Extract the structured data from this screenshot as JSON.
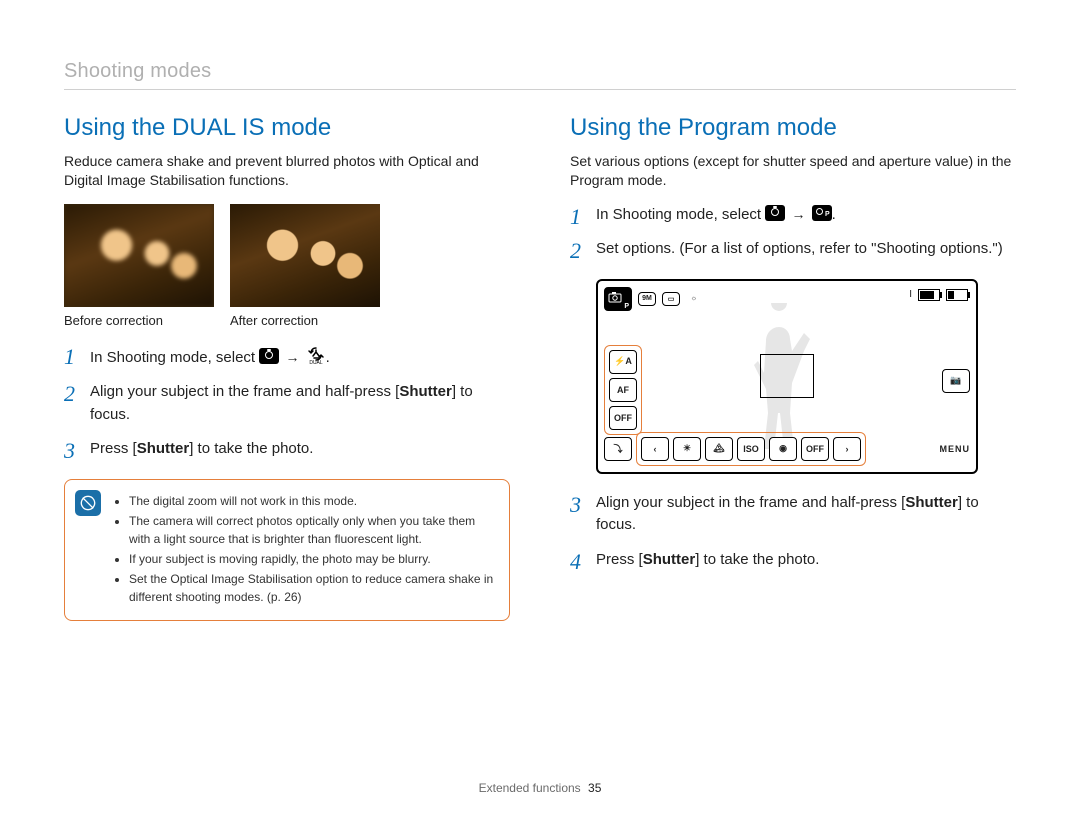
{
  "header": "Shooting modes",
  "left": {
    "title": "Using the DUAL IS mode",
    "intro": "Reduce camera shake and prevent blurred photos with Optical and Digital Image Stabilisation functions.",
    "caption_before": "Before correction",
    "caption_after": "After correction",
    "steps": {
      "1_prefix": "In Shooting mode, select ",
      "2_a": "Align your subject in the frame and half-press [",
      "2_shutter": "Shutter",
      "2_b": "] to focus.",
      "3_a": "Press [",
      "3_shutter": "Shutter",
      "3_b": "] to take the photo."
    },
    "notes": [
      "The digital zoom will not work in this mode.",
      "The camera will correct photos optically only when you take them with a light source that is brighter than fluorescent light.",
      "If your subject is moving rapidly, the photo may be blurry.",
      "Set the Optical Image Stabilisation option to reduce camera shake in different shooting modes. (p. 26)"
    ]
  },
  "right": {
    "title": "Using the Program mode",
    "intro": "Set various options (except for shutter speed and aperture value) in the Program mode.",
    "steps": {
      "1_prefix": "In Shooting mode, select ",
      "2": "Set options. (For a list of options, refer to \"Shooting options.\")",
      "3_a": "Align your subject in the frame and half-press [",
      "3_shutter": "Shutter",
      "3_b": "] to focus.",
      "4_a": "Press [",
      "4_shutter": "Shutter",
      "4_b": "] to take the photo."
    }
  },
  "screen": {
    "mode_badge": "P",
    "top_small": [
      "9M",
      "▭",
      "☼"
    ],
    "top_right_counter": "I",
    "left_buttons": [
      "⚡A",
      "AF",
      "OFF"
    ],
    "bottom_left": "⤵",
    "bottom_group": [
      "‹",
      "☀",
      "🏔",
      "ISO",
      "◉",
      "OFF",
      "›"
    ],
    "menu_label": "MENU",
    "right_cam": "📷"
  },
  "footer": {
    "section": "Extended functions",
    "page": "35"
  }
}
